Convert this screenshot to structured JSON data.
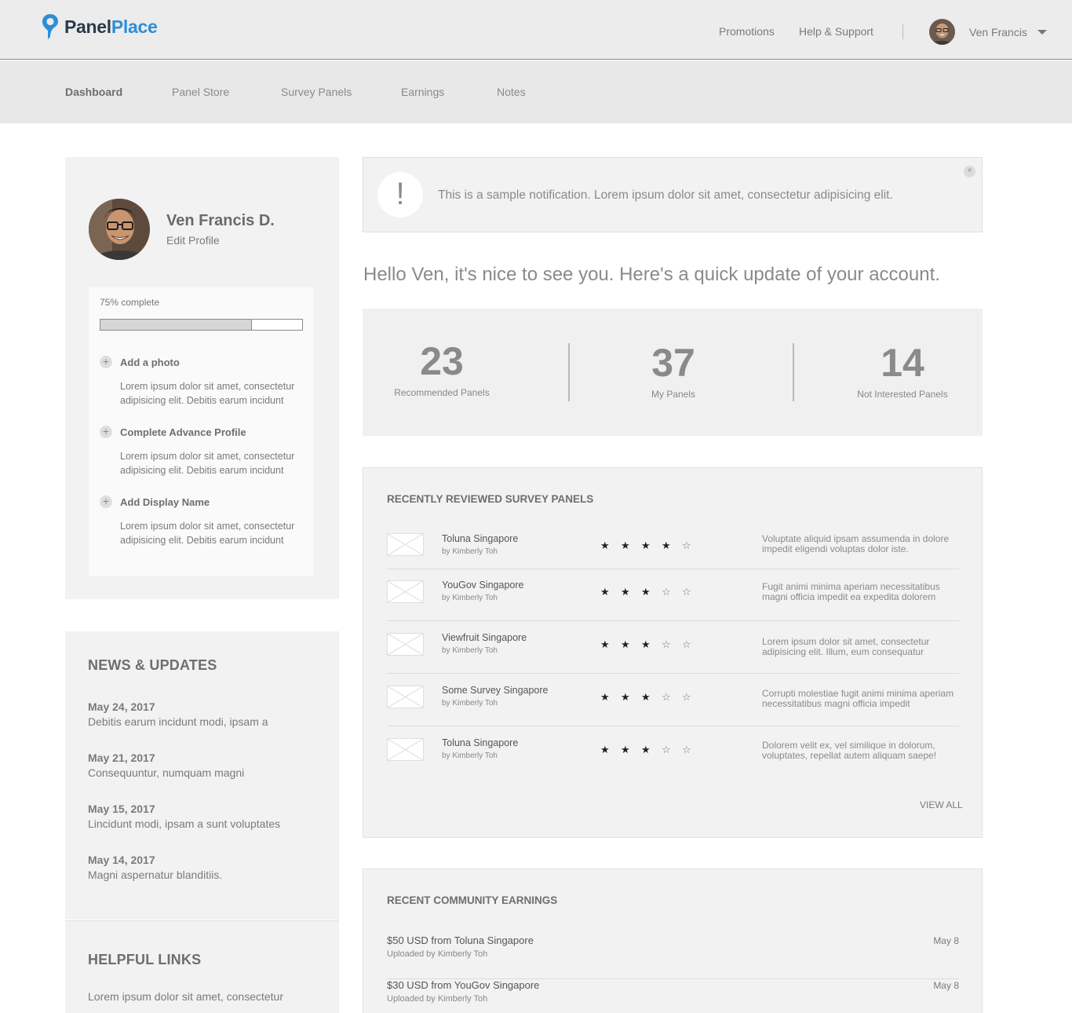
{
  "brand": {
    "part1": "Panel",
    "part2": "Place",
    "accent": "#2c8fd6",
    "dark": "#2b3a4a"
  },
  "topnav": {
    "promotions": "Promotions",
    "help": "Help & Support",
    "username": "Ven Francis"
  },
  "subnav": {
    "items": [
      "Dashboard",
      "Panel Store",
      "Survey Panels",
      "Earnings",
      "Notes"
    ],
    "active": "Dashboard"
  },
  "profile": {
    "name": "Ven Francis D.",
    "edit_label": "Edit Profile",
    "completion_label": "75% complete",
    "completion_percent": 75,
    "tasks": [
      {
        "title": "Add a photo",
        "desc": "Lorem ipsum dolor sit amet, consectetur adipisicing elit. Debitis earum incidunt"
      },
      {
        "title": "Complete Advance Profile",
        "desc": "Lorem ipsum dolor sit amet, consectetur adipisicing elit. Debitis earum incidunt"
      },
      {
        "title": "Add Display Name",
        "desc": "Lorem ipsum dolor sit amet, consectetur adipisicing elit. Debitis earum incidunt"
      }
    ]
  },
  "news": {
    "title": "NEWS & UPDATES",
    "items": [
      {
        "date": "May 24, 2017",
        "text": "Debitis earum incidunt modi, ipsam a"
      },
      {
        "date": "May 21, 2017",
        "text": "Consequuntur, numquam magni"
      },
      {
        "date": "May 15, 2017",
        "text": "Lincidunt modi, ipsam a sunt voluptates"
      },
      {
        "date": "May 14, 2017",
        "text": "Magni aspernatur blanditiis."
      }
    ]
  },
  "helpful": {
    "title": "HELPFUL LINKS",
    "text": "Lorem ipsum dolor sit amet, consectetur"
  },
  "notification": {
    "icon": "!",
    "text": "This is a sample notification. Lorem ipsum dolor sit amet, consectetur adipisicing elit.",
    "close": "×"
  },
  "greeting": "Hello Ven, it's nice to see you. Here's a quick update of your account.",
  "stats": [
    {
      "value": "23",
      "label": "Recommended Panels"
    },
    {
      "value": "37",
      "label": "My Panels"
    },
    {
      "value": "14",
      "label": "Not Interested Panels"
    }
  ],
  "reviewed": {
    "title": "RECENTLY REVIEWED SURVEY PANELS",
    "view_all": "VIEW ALL",
    "rows": [
      {
        "name": "Toluna Singapore",
        "by": "by Kimberly Toh",
        "rating": 4,
        "desc": "Voluptate aliquid ipsam assumenda in dolore impedit eligendi voluptas dolor iste."
      },
      {
        "name": "YouGov Singapore",
        "by": "by Kimberly Toh",
        "rating": 3,
        "desc": "Fugit animi minima aperiam necessitatibus magni officia impedit ea expedita dolorem"
      },
      {
        "name": "Viewfruit Singapore",
        "by": "by Kimberly Toh",
        "rating": 3,
        "desc": "Lorem ipsum dolor sit amet, consectetur adipisicing elit. Illum, eum consequatur"
      },
      {
        "name": "Some Survey Singapore",
        "by": "by Kimberly Toh",
        "rating": 3,
        "desc": "Corrupti molestiae fugit animi minima aperiam necessitatibus magni officia impedit"
      },
      {
        "name": "Toluna Singapore",
        "by": "by Kimberly Toh",
        "rating": 3,
        "desc": "Dolorem velit ex, vel similique in dolorum, voluptates, repellat autem aliquam saepe!"
      }
    ]
  },
  "earnings": {
    "title": "RECENT COMMUNITY EARNINGS",
    "rows": [
      {
        "title": "$50 USD from Toluna Singapore",
        "sub": "Uploaded by Kimberly Toh",
        "date": "May 8"
      },
      {
        "title": "$30 USD from YouGov Singapore",
        "sub": "Uploaded by Kimberly Toh",
        "date": "May 8"
      }
    ]
  }
}
